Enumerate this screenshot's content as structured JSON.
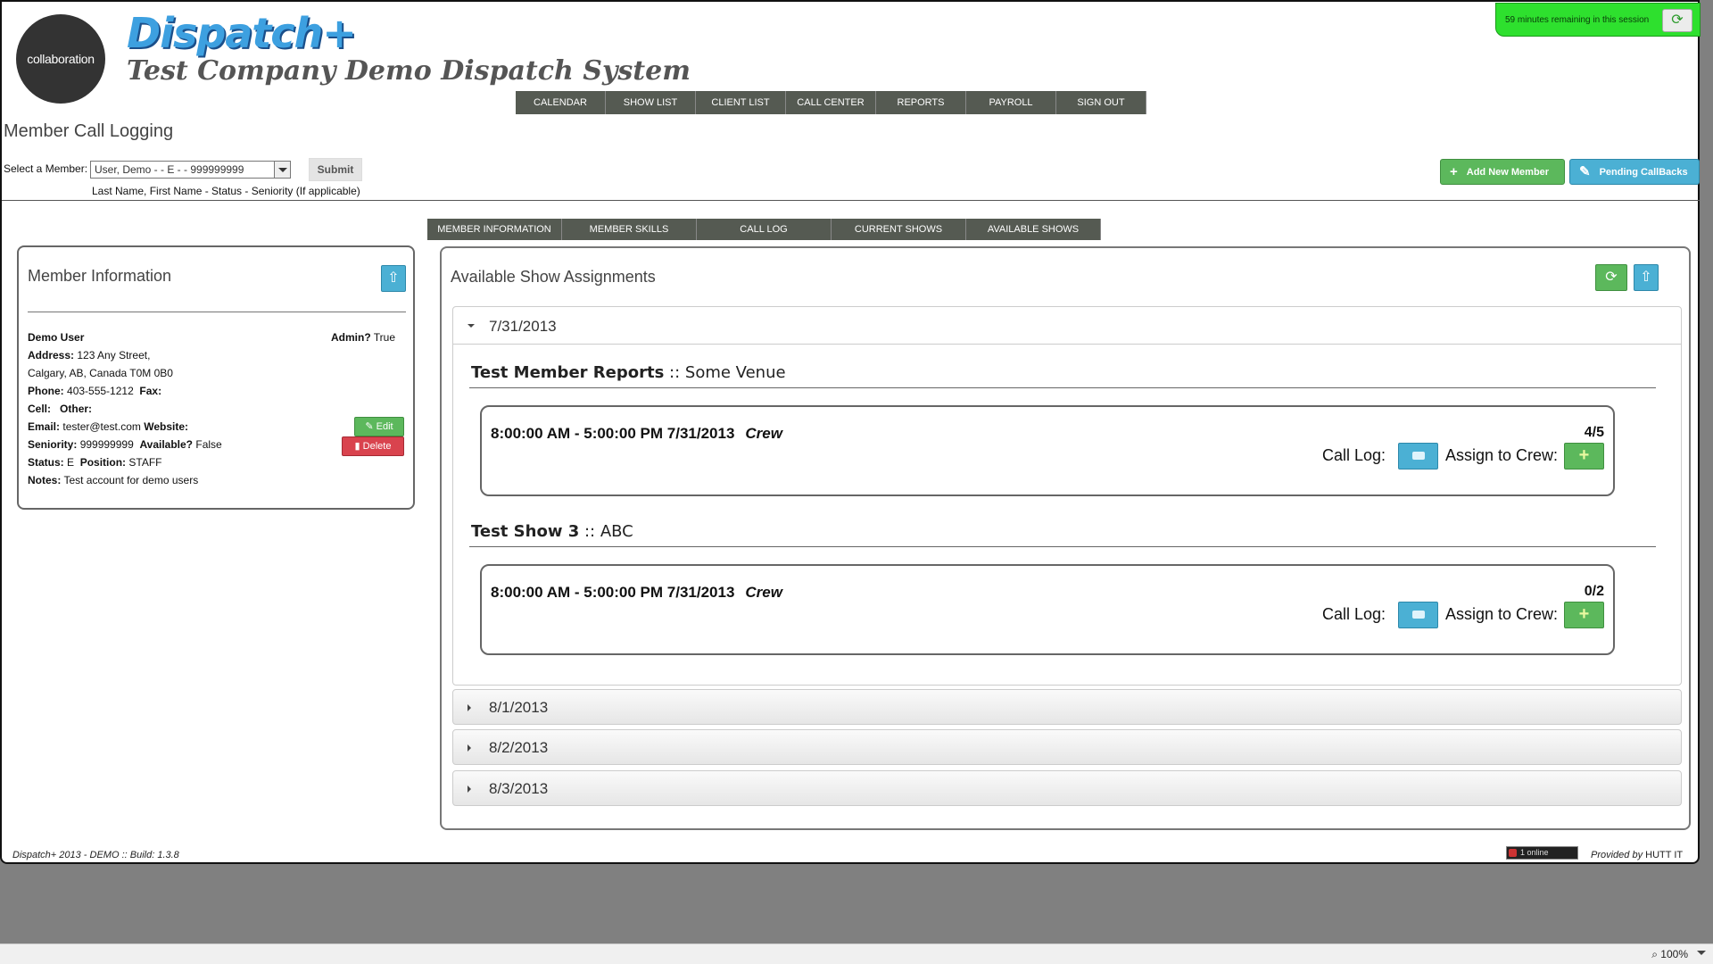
{
  "header": {
    "logo_text": "collaboration",
    "brand": "Dispatch+",
    "system_title": "Test Company Demo Dispatch System",
    "session_text": "59 minutes remaining in this session",
    "session_icon": "refresh-icon"
  },
  "topnav": [
    "CALENDAR",
    "SHOW LIST",
    "CLIENT LIST",
    "CALL CENTER",
    "REPORTS",
    "PAYROLL",
    "SIGN OUT"
  ],
  "page_title": "Member Call Logging",
  "member_select": {
    "label": "Select a Member:",
    "value": "User, Demo - - E - - 999999999",
    "hint": "Last Name, First Name - Status - Seniority (If applicable)",
    "submit_label": "Submit"
  },
  "actions": {
    "add_member": "Add New Member",
    "pending": "Pending CallBacks"
  },
  "subnav": [
    "MEMBER INFORMATION",
    "MEMBER SKILLS",
    "CALL LOG",
    "CURRENT SHOWS",
    "AVAILABLE SHOWS"
  ],
  "member_info": {
    "title": "Member Information",
    "name": "Demo User",
    "admin_label": "Admin?",
    "admin_value": "True",
    "address_label": "Address:",
    "address_line1": "123 Any Street,",
    "address_line2": "Calgary, AB, Canada  T0M 0B0",
    "phone_label": "Phone:",
    "phone_value": "403-555-1212",
    "fax_label": "Fax:",
    "cell_label": "Cell:",
    "other_label": "Other:",
    "email_label": "Email:",
    "email_value": "tester@test.com",
    "website_label": "Website:",
    "seniority_label": "Seniority:",
    "seniority_value": "999999999",
    "available_label": "Available?",
    "available_value": "False",
    "status_label": "Status:",
    "status_value": "E",
    "position_label": "Position:",
    "position_value": "STAFF",
    "notes_label": "Notes:",
    "notes_value": "Test account for demo users",
    "edit_label": "Edit",
    "delete_label": "Delete"
  },
  "shows": {
    "title": "Available Show Assignments",
    "open_date": "7/31/2013",
    "groups": [
      {
        "show": "Test Member Reports",
        "venue": ":: Some Venue",
        "time": "8:00:00 AM - 5:00:00 PM 7/31/2013",
        "role": "Crew",
        "count": "4/5"
      },
      {
        "show": "Test Show 3",
        "venue": ":: ABC",
        "time": "8:00:00 AM - 5:00:00 PM 7/31/2013",
        "role": "Crew",
        "count": "0/2"
      }
    ],
    "call_log_label": "Call Log:",
    "assign_label": "Assign to Crew:",
    "closed_dates": [
      "8/1/2013",
      "8/2/2013",
      "8/3/2013"
    ]
  },
  "footer": {
    "build": "Dispatch+ 2013 - DEMO :: Build: 1.3.8",
    "counter": "1 online",
    "provided_by": "Provided by",
    "provider": "HUTT IT"
  },
  "browser": {
    "zoom": "100%"
  },
  "colors": {
    "nav_bg": "#555a52",
    "green": "#5cb85c",
    "blue": "#4bb0d4",
    "red": "#d9434e",
    "session_green": "#2ee02e"
  }
}
